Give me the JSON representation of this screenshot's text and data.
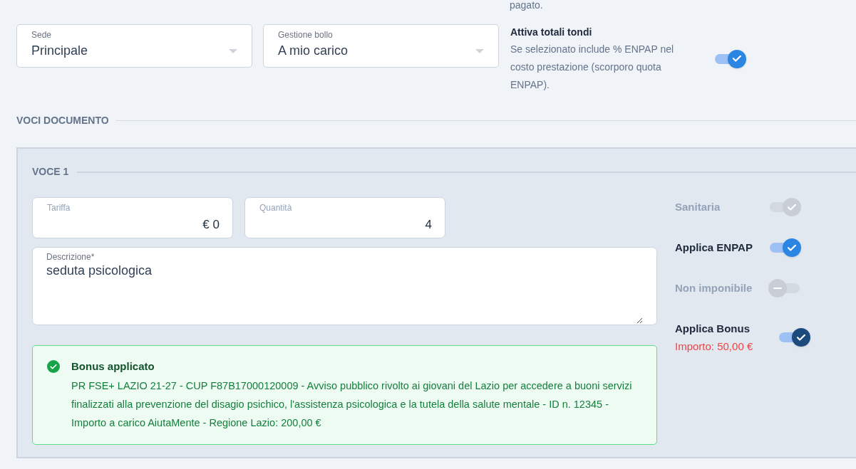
{
  "top_fragment": "pagato.",
  "selects": [
    {
      "label": "Sede",
      "value": "Principale"
    },
    {
      "label": "Gestione bollo",
      "value": "A mio carico"
    }
  ],
  "round_totals": {
    "title": "Attiva totali tondi",
    "description": "Se selezionato include % ENPAP nel costo prestazione (scorporo quota ENPAP).",
    "on": true,
    "disabled": false,
    "color": "#2b86e3"
  },
  "section_title": "VOCI DOCUMENTO",
  "item": {
    "title": "VOCE 1",
    "fields": [
      {
        "label": "Tariffa",
        "value": "€ 0"
      },
      {
        "label": "Quantità",
        "value": "4"
      }
    ],
    "description": {
      "label": "Descrizione*",
      "value": "seduta psicologica"
    },
    "bonus": {
      "title": "Bonus applicato",
      "text": "PR FSE+ LAZIO 21-27 - CUP F87B17000120009 - Avviso pubblico rivolto ai giovani del Lazio per accedere a buoni servizi finalizzati alla prevenzione del disagio psichico, l'assistenza psicologica e la tutela della salute mentale - ID n. 12345 - Importo a carico AiutaMente - Regione Lazio: 200,00 €"
    },
    "toggles": [
      {
        "label": "Sanitaria",
        "on": true,
        "disabled": true,
        "color": "#c9ced6"
      },
      {
        "label": "Applica ENPAP",
        "on": true,
        "disabled": false,
        "color": "#2b86e3"
      },
      {
        "label": "Non imponibile",
        "on": false,
        "disabled": true,
        "color": "#c9ced6"
      },
      {
        "label": "Applica Bonus",
        "note": "Importo: 50,00 €",
        "on": true,
        "disabled": false,
        "color": "#1c4a7c"
      }
    ]
  }
}
